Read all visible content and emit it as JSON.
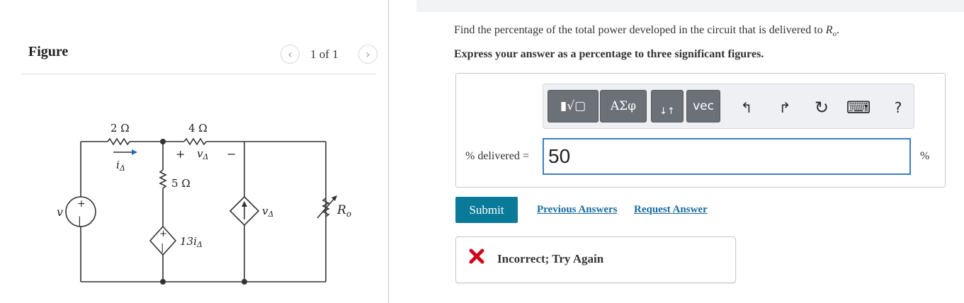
{
  "figure": {
    "title": "Figure",
    "pager": {
      "count": "1 of 1",
      "prev_glyph": "‹",
      "next_glyph": "›"
    },
    "circuit": {
      "labels": {
        "r1": "2 Ω",
        "r2": "4 Ω",
        "r3": "5 Ω",
        "i_delta": "i",
        "i_delta_sub": "Δ",
        "v_delta_plus": "+",
        "v_delta": "v",
        "v_delta_sub": "Δ",
        "v_delta_minus": "−",
        "source_v": "v",
        "dep_v": "13i",
        "dep_v_sub": "Δ",
        "dep_i": "v",
        "dep_i_sub": "Δ",
        "ro": "R",
        "ro_sub": "o"
      }
    }
  },
  "question": {
    "prompt_prefix": "Find the percentage of the total power developed in the circuit that is delivered to ",
    "prompt_var": "R",
    "prompt_sub": "o",
    "prompt_suffix": ".",
    "instruction": "Express your answer as a percentage to three significant figures."
  },
  "toolbar": {
    "templates_label": "▮√▢",
    "greek_label": "ΑΣφ",
    "arrows_label": "↓↑",
    "vec_label": "vec",
    "undo_glyph": "↰",
    "redo_glyph": "↱",
    "reset_glyph": "↻",
    "keyboard_glyph": "⌨",
    "help_glyph": "?"
  },
  "answer": {
    "label": "% delivered =",
    "value": "50",
    "unit": "%"
  },
  "actions": {
    "submit": "Submit",
    "previous_answers": "Previous Answers",
    "request_answer": "Request Answer"
  },
  "feedback": {
    "message": "Incorrect; Try Again",
    "color": "#d0021b"
  }
}
